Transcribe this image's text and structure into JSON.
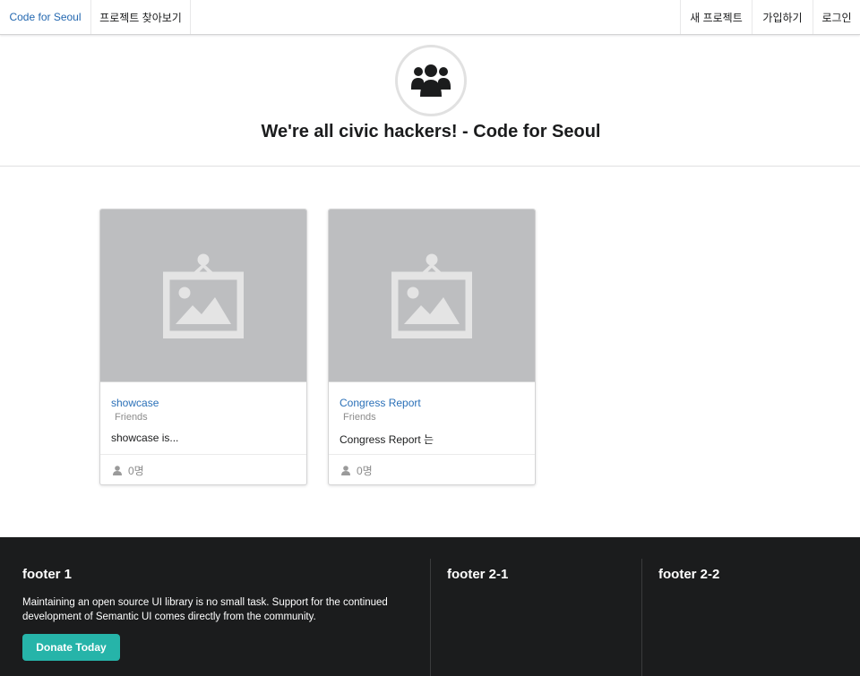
{
  "nav": {
    "brand": "Code for Seoul",
    "explore": "프로젝트 찾아보기",
    "new_project": "새 프로젝트",
    "signup": "가입하기",
    "login": "로그인"
  },
  "header": {
    "icon": "users-icon",
    "title": "We're all civic hackers! - Code for Seoul"
  },
  "cards": [
    {
      "title": "showcase",
      "meta": "Friends",
      "description": "showcase is...",
      "members": "0명",
      "image_icon": "image-placeholder-icon"
    },
    {
      "title": "Congress Report",
      "meta": "Friends",
      "description": "Congress Report 는",
      "members": "0명",
      "image_icon": "image-placeholder-icon"
    }
  ],
  "footer": {
    "col1": {
      "title": "footer 1",
      "text": "Maintaining an open source UI library is no small task. Support for the continued development of Semantic UI comes directly from the community.",
      "button": "Donate Today"
    },
    "col2": {
      "title": "footer 2-1"
    },
    "col3": {
      "title": "footer 2-2"
    }
  },
  "colors": {
    "link": "#2a70b8",
    "footer_bg": "#1b1c1d",
    "button": "#26b4a9",
    "placeholder": "#bdbec0"
  }
}
